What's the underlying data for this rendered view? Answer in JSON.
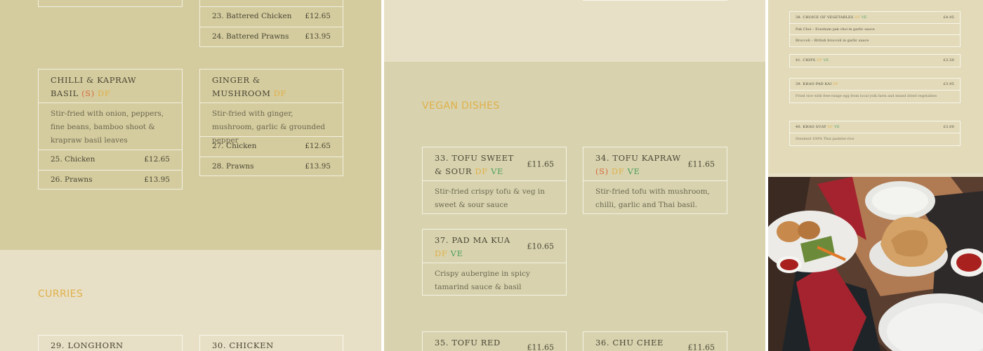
{
  "panel1": {
    "top_card": {
      "rows": [
        {
          "label": "23. Battered Chicken",
          "price": "£12.65"
        },
        {
          "label": "24. Battered Prawns",
          "price": "£13.95"
        }
      ]
    },
    "chilli": {
      "name": "CHILLI & KAPRAW BASIL",
      "tag_s": "(S)",
      "tag_df": "DF",
      "desc": "Stir-fried with onion, peppers, fine beans, bamboo shoot & krapraw basil leaves",
      "rows": [
        {
          "label": "25. Chicken",
          "price": "£12.65"
        },
        {
          "label": "26. Prawns",
          "price": "£13.95"
        }
      ]
    },
    "ginger": {
      "name": "GINGER & MUSHROOM",
      "tag_df": "DF",
      "desc": "Stir-fried with ginger, mushroom, garlic & grounded pepper",
      "rows": [
        {
          "label": "27. Chicken",
          "price": "£12.65"
        },
        {
          "label": "28. Prawns",
          "price": "£13.95"
        }
      ]
    },
    "section_curries": "CURRIES",
    "curry1": "29. LONGHORN",
    "curry2": "30. CHICKEN"
  },
  "panel2": {
    "section_vegan": "VEGAN DISHES",
    "tofu_sweet": {
      "name": "33. TOFU SWEET & SOUR",
      "tag_df": "DF",
      "tag_ve": "VE",
      "price": "£11.65",
      "desc": "Stir-fried crispy tofu & veg in sweet & sour sauce"
    },
    "tofu_kapraw": {
      "name": "34. TOFU KAPRAW",
      "tag_s": "(S)",
      "tag_df": "DF",
      "tag_ve": "VE",
      "price": "£11.65",
      "desc": "Stir-fried tofu with mushroom, chilli, garlic and Thai basil."
    },
    "pad_ma_kua": {
      "name": "37. PAD MA KUA",
      "tag_df": "DF",
      "tag_ve": "VE",
      "price": "£10.65",
      "desc": "Crispy aubergine in spicy tamarind sauce & basil"
    },
    "tofu_red": {
      "name": "35. TOFU RED",
      "price": "£11.65"
    },
    "chu_chee": {
      "name": "36. CHU CHEE",
      "price": "£11.65"
    }
  },
  "panel3": {
    "veg": {
      "name": "38. CHOICE OF VEGETABLES",
      "tag_df": "DF",
      "tag_ve": "VE",
      "price": "£4.95",
      "lines": [
        "Pak Choi – Evesham pak choi in garlic sauce",
        "Broccoli – British broccoli in garlic sauce"
      ]
    },
    "chips": {
      "name": "41. CHIPS",
      "tag_df": "DF",
      "tag_ve": "VE",
      "price": "£3.50"
    },
    "khao_pad": {
      "name": "39. KHAO PAD KAI",
      "tag_df": "DF",
      "price": "£3.95",
      "desc": "Fried rice with free-range egg from local yolk farm and mixed dried vegetables"
    },
    "khao_suay": {
      "name": "40. KHAO SUAY",
      "tag_df": "DF",
      "tag_ve": "VE",
      "price": "£3.00",
      "desc": "Steamed 100% Thai jasmine rice"
    }
  },
  "colors": {
    "olive": "#d4cc9e",
    "cream": "#e8e0c6",
    "gold": "#e0b04a",
    "green": "#4f9e5c",
    "orange": "#d9683a"
  }
}
